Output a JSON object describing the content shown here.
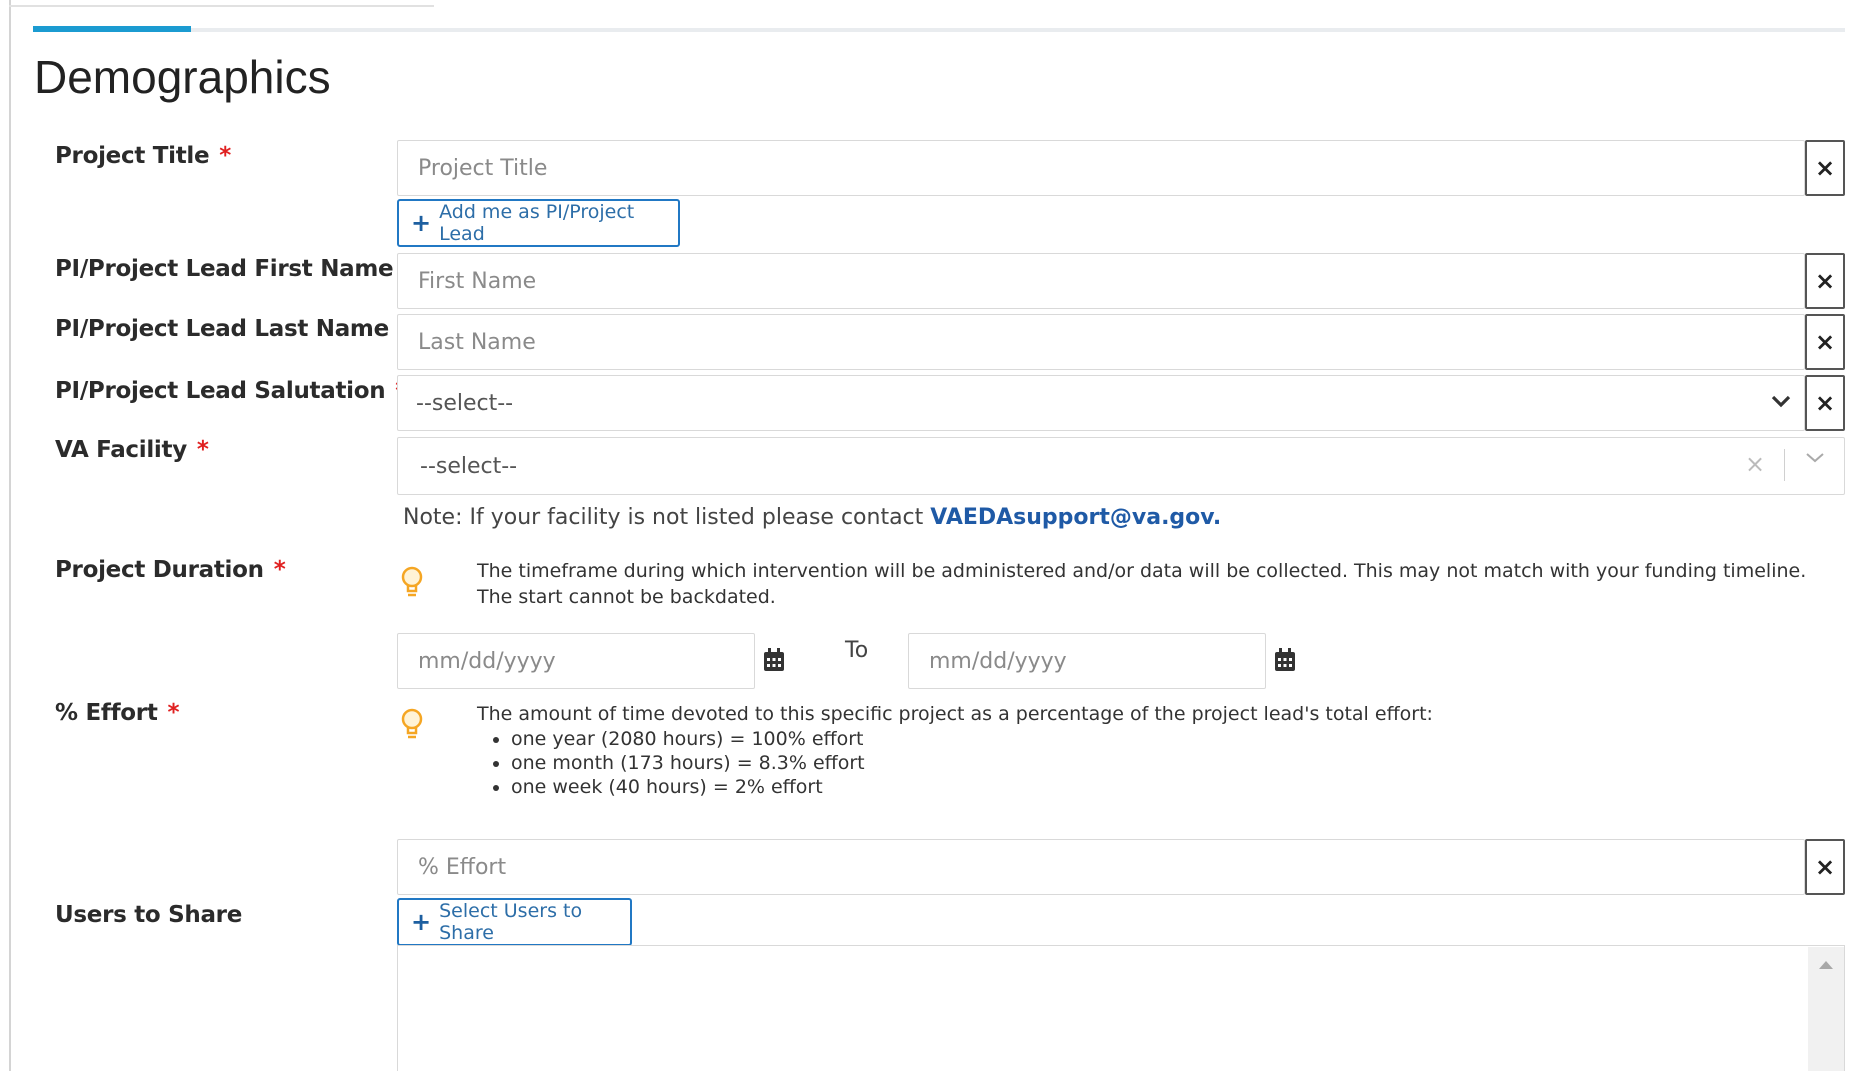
{
  "page": {
    "title": "Demographics"
  },
  "form": {
    "required_marker": "*",
    "project_title": {
      "label": "Project Title",
      "placeholder": "Project Title"
    },
    "add_me_button": {
      "label": "Add me as PI/Project Lead"
    },
    "first_name": {
      "label": "PI/Project Lead First Name",
      "placeholder": "First Name"
    },
    "last_name": {
      "label": "PI/Project Lead Last Name",
      "placeholder": "Last Name"
    },
    "salutation": {
      "label": "PI/Project Lead Salutation",
      "value": "--select--"
    },
    "va_facility": {
      "label": "VA Facility",
      "value": "--select--",
      "note_prefix": "Note: If your facility is not listed please contact ",
      "note_email": "VAEDAsupport@va.gov."
    },
    "project_duration": {
      "label": "Project Duration",
      "help": "The timeframe during which intervention will be administered and/or data will be collected. This may not match with your funding timeline. The start cannot be backdated.",
      "start_placeholder": "mm/dd/yyyy",
      "to_label": "To",
      "end_placeholder": "mm/dd/yyyy"
    },
    "effort": {
      "label": "% Effort",
      "help": "The amount of time devoted to this specific project as a percentage of the project lead's total effort:",
      "bullets": [
        "one year (2080 hours) = 100% effort",
        "one month (173 hours) = 8.3% effort",
        "one week (40 hours) = 2% effort"
      ],
      "placeholder": "% Effort"
    },
    "users_to_share": {
      "label": "Users to Share",
      "button_label": "Select Users to Share"
    },
    "clear_symbol": "×"
  },
  "icons": {
    "clear": "close-icon",
    "dropdown": "chevron-down-icon",
    "help": "lightbulb-icon",
    "calendar": "calendar-icon",
    "add": "plus-icon"
  },
  "colors": {
    "accent": "#1b9bd1",
    "required": "#e02020",
    "link": "#1f5aa6",
    "button_border": "#2178c4",
    "help_icon": "#f5a623"
  },
  "progress": {
    "fraction": 0.087
  }
}
